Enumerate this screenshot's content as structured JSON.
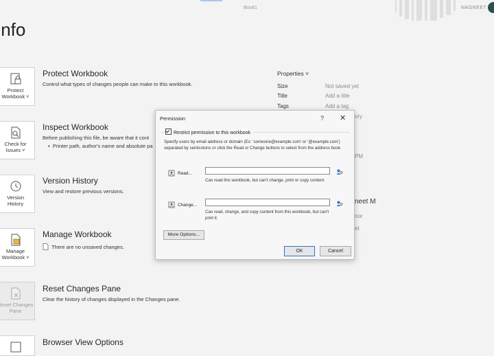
{
  "topbar": {
    "doc_title": "Book1",
    "user": "NAGNEET"
  },
  "page_title": "Info",
  "sections": {
    "protect": {
      "button": "Protect\nWorkbook ˅",
      "title": "Protect Workbook",
      "desc": "Control what types of changes people can make to this workbook."
    },
    "inspect": {
      "button": "Check for\nIssues ˅",
      "title": "Inspect Workbook",
      "desc": "Before publishing this file, be aware that it cont",
      "bullet": "Printer path, author's name and absolute pa"
    },
    "version": {
      "button": "Version\nHistory",
      "title": "Version History",
      "desc": "View and restore previous versions."
    },
    "manage": {
      "button": "Manage\nWorkbook ˅",
      "title": "Manage Workbook",
      "desc": "There are no unsaved changes."
    },
    "reset": {
      "button": "Reset Changes\nPane",
      "title": "Reset Changes Pane",
      "desc": "Clear the history of changes displayed in the Changes pane."
    },
    "browser": {
      "title": "Browser View Options"
    }
  },
  "properties": {
    "header": "Properties ˅",
    "rows": [
      {
        "key": "Size",
        "value": "Not saved yet"
      },
      {
        "key": "Title",
        "value": "Add a title"
      },
      {
        "key": "Tags",
        "value": "Add a tag"
      }
    ],
    "fragments": [
      "ory",
      "PM",
      "neet M",
      "nor",
      "et"
    ]
  },
  "dialog": {
    "title": "Permission",
    "help": "?",
    "close": "✕",
    "restrict_label": "Restrict permission to this workbook",
    "instructions": "Specify users by email address or domain (Ex: 'someone@example.com' or '@example.com') separated by semicolons or click the Read or Change buttons to select from the address book.",
    "read": {
      "label": "Read...",
      "value": "",
      "help": "Can read this workbook, but can't change, print or copy content."
    },
    "change": {
      "label": "Change...",
      "value": "",
      "help": "Can read, change, and copy content from this workbook, but can't print it."
    },
    "more_options": "More Options...",
    "ok": "OK",
    "cancel": "Cancel"
  }
}
